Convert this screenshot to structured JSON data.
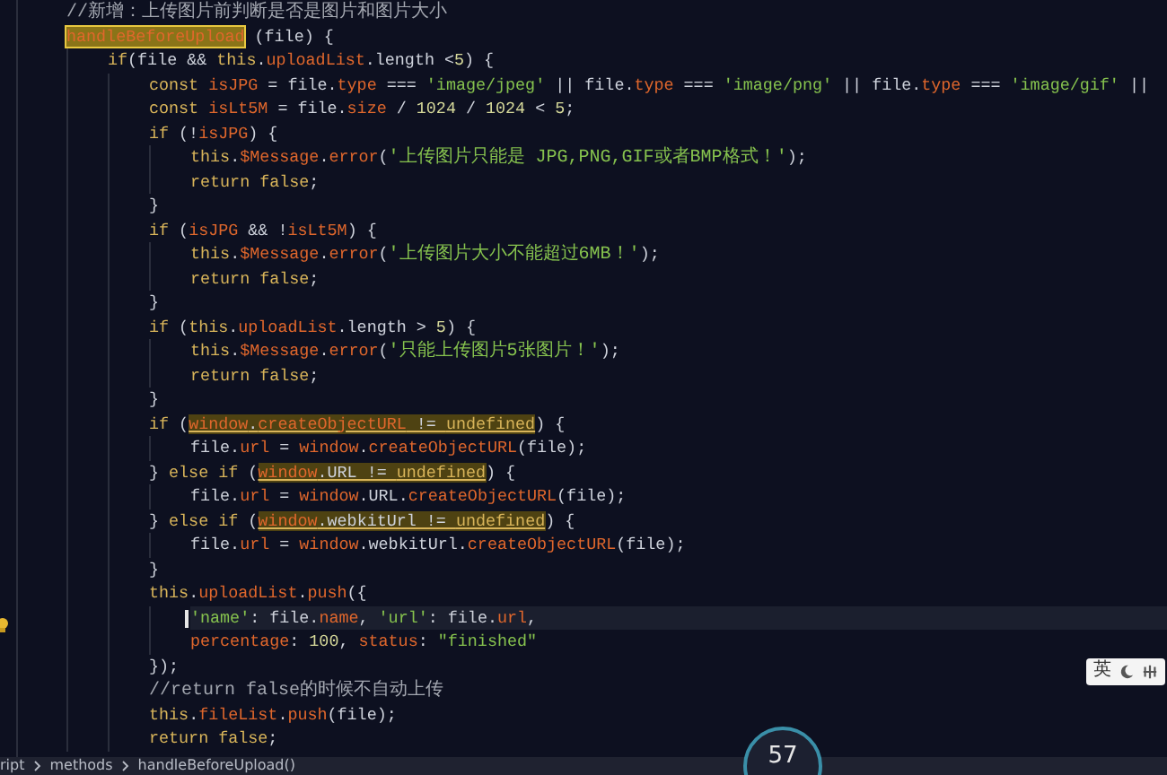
{
  "editor": {
    "lines": [
      {
        "tokens": [
          {
            "kind": "comment",
            "text": "//新增：上传图片前判断是否是图片和图片大小"
          }
        ]
      },
      {
        "tokens": [
          {
            "kind": "current_match",
            "tokens": [
              {
                "kind": "prop",
                "text": "handleBeforeUpload"
              }
            ]
          },
          {
            "kind": "plain",
            "text": " (file) {"
          }
        ],
        "children": [
          {
            "tokens": [
              {
                "kind": "kw",
                "text": "if"
              },
              {
                "kind": "plain",
                "text": "(file && "
              },
              {
                "kind": "kw",
                "text": "this"
              },
              {
                "kind": "plain",
                "text": "."
              },
              {
                "kind": "prop",
                "text": "uploadList"
              },
              {
                "kind": "plain",
                "text": ".length <"
              },
              {
                "kind": "num",
                "text": "5"
              },
              {
                "kind": "plain",
                "text": ") {"
              }
            ],
            "children": [
              {
                "tokens": [
                  {
                    "kind": "kw",
                    "text": "const "
                  },
                  {
                    "kind": "prop",
                    "text": "isJPG"
                  },
                  {
                    "kind": "plain",
                    "text": " = file."
                  },
                  {
                    "kind": "prop",
                    "text": "type"
                  },
                  {
                    "kind": "plain",
                    "text": " === "
                  },
                  {
                    "kind": "str",
                    "text": "'image/jpeg'"
                  },
                  {
                    "kind": "plain",
                    "text": " || file."
                  },
                  {
                    "kind": "prop",
                    "text": "type"
                  },
                  {
                    "kind": "plain",
                    "text": " === "
                  },
                  {
                    "kind": "str",
                    "text": "'image/png'"
                  },
                  {
                    "kind": "plain",
                    "text": " || file."
                  },
                  {
                    "kind": "prop",
                    "text": "type"
                  },
                  {
                    "kind": "plain",
                    "text": " === "
                  },
                  {
                    "kind": "str",
                    "text": "'image/gif'"
                  },
                  {
                    "kind": "plain",
                    "text": " ||"
                  }
                ]
              },
              {
                "tokens": [
                  {
                    "kind": "kw",
                    "text": "const "
                  },
                  {
                    "kind": "prop",
                    "text": "isLt5M"
                  },
                  {
                    "kind": "plain",
                    "text": " = file."
                  },
                  {
                    "kind": "prop",
                    "text": "size"
                  },
                  {
                    "kind": "plain",
                    "text": " / "
                  },
                  {
                    "kind": "num",
                    "text": "1024"
                  },
                  {
                    "kind": "plain",
                    "text": " / "
                  },
                  {
                    "kind": "num",
                    "text": "1024"
                  },
                  {
                    "kind": "plain",
                    "text": " < "
                  },
                  {
                    "kind": "num",
                    "text": "5"
                  },
                  {
                    "kind": "plain",
                    "text": ";"
                  }
                ]
              },
              {
                "tokens": [
                  {
                    "kind": "kw",
                    "text": "if"
                  },
                  {
                    "kind": "plain",
                    "text": " (!"
                  },
                  {
                    "kind": "prop",
                    "text": "isJPG"
                  },
                  {
                    "kind": "plain",
                    "text": ") {"
                  }
                ],
                "children": [
                  {
                    "tokens": [
                      {
                        "kind": "kw",
                        "text": "this"
                      },
                      {
                        "kind": "plain",
                        "text": "."
                      },
                      {
                        "kind": "prop",
                        "text": "$Message"
                      },
                      {
                        "kind": "plain",
                        "text": "."
                      },
                      {
                        "kind": "prop",
                        "text": "error"
                      },
                      {
                        "kind": "plain",
                        "text": "("
                      },
                      {
                        "kind": "message",
                        "text": "'上传图片只能是 JPG,PNG,GIF或者BMP格式！'"
                      },
                      {
                        "kind": "plain",
                        "text": ");"
                      }
                    ]
                  },
                  {
                    "tokens": [
                      {
                        "kind": "kw",
                        "text": "return false"
                      },
                      {
                        "kind": "plain",
                        "text": ";"
                      }
                    ]
                  }
                ]
              },
              {
                "tokens": [
                  {
                    "kind": "plain",
                    "text": "}"
                  }
                ]
              },
              {
                "tokens": [
                  {
                    "kind": "kw",
                    "text": "if"
                  },
                  {
                    "kind": "plain",
                    "text": " ("
                  },
                  {
                    "kind": "prop",
                    "text": "isJPG"
                  },
                  {
                    "kind": "plain",
                    "text": " && !"
                  },
                  {
                    "kind": "prop",
                    "text": "isLt5M"
                  },
                  {
                    "kind": "plain",
                    "text": ") {"
                  }
                ],
                "children": [
                  {
                    "tokens": [
                      {
                        "kind": "kw",
                        "text": "this"
                      },
                      {
                        "kind": "plain",
                        "text": "."
                      },
                      {
                        "kind": "prop",
                        "text": "$Message"
                      },
                      {
                        "kind": "plain",
                        "text": "."
                      },
                      {
                        "kind": "prop",
                        "text": "error"
                      },
                      {
                        "kind": "plain",
                        "text": "("
                      },
                      {
                        "kind": "message",
                        "text": "'上传图片大小不能超过6MB！'"
                      },
                      {
                        "kind": "plain",
                        "text": ");"
                      }
                    ]
                  },
                  {
                    "tokens": [
                      {
                        "kind": "kw",
                        "text": "return false"
                      },
                      {
                        "kind": "plain",
                        "text": ";"
                      }
                    ]
                  }
                ]
              },
              {
                "tokens": [
                  {
                    "kind": "plain",
                    "text": "}"
                  }
                ]
              },
              {
                "tokens": [
                  {
                    "kind": "kw",
                    "text": "if"
                  },
                  {
                    "kind": "plain",
                    "text": " ("
                  },
                  {
                    "kind": "kw",
                    "text": "this"
                  },
                  {
                    "kind": "plain",
                    "text": "."
                  },
                  {
                    "kind": "prop",
                    "text": "uploadList"
                  },
                  {
                    "kind": "plain",
                    "text": ".length > "
                  },
                  {
                    "kind": "num",
                    "text": "5"
                  },
                  {
                    "kind": "plain",
                    "text": ") {"
                  }
                ],
                "children": [
                  {
                    "tokens": [
                      {
                        "kind": "kw",
                        "text": "this"
                      },
                      {
                        "kind": "plain",
                        "text": "."
                      },
                      {
                        "kind": "prop",
                        "text": "$Message"
                      },
                      {
                        "kind": "plain",
                        "text": "."
                      },
                      {
                        "kind": "prop",
                        "text": "error"
                      },
                      {
                        "kind": "plain",
                        "text": "("
                      },
                      {
                        "kind": "message",
                        "text": "'只能上传图片5张图片！'"
                      },
                      {
                        "kind": "plain",
                        "text": ");"
                      }
                    ]
                  },
                  {
                    "tokens": [
                      {
                        "kind": "kw",
                        "text": "return false"
                      },
                      {
                        "kind": "plain",
                        "text": ";"
                      }
                    ]
                  }
                ]
              },
              {
                "tokens": [
                  {
                    "kind": "plain",
                    "text": "}"
                  }
                ]
              },
              {
                "tokens": [
                  {
                    "kind": "kw",
                    "text": "if"
                  },
                  {
                    "kind": "plain",
                    "text": " ("
                  },
                  {
                    "kind": "match",
                    "tokens": [
                      {
                        "kind": "prop",
                        "text": "window"
                      },
                      {
                        "kind": "plain",
                        "text": "."
                      },
                      {
                        "kind": "prop",
                        "text": "createObjectURL"
                      },
                      {
                        "kind": "plain",
                        "text": " != "
                      },
                      {
                        "kind": "kw",
                        "text": "undefined"
                      }
                    ]
                  },
                  {
                    "kind": "plain",
                    "text": ") {"
                  }
                ],
                "children": [
                  {
                    "tokens": [
                      {
                        "kind": "plain",
                        "text": "file."
                      },
                      {
                        "kind": "prop",
                        "text": "url"
                      },
                      {
                        "kind": "plain",
                        "text": " = "
                      },
                      {
                        "kind": "prop",
                        "text": "window"
                      },
                      {
                        "kind": "plain",
                        "text": "."
                      },
                      {
                        "kind": "prop",
                        "text": "createObjectURL"
                      },
                      {
                        "kind": "plain",
                        "text": "(file);"
                      }
                    ]
                  }
                ]
              },
              {
                "tokens": [
                  {
                    "kind": "plain",
                    "text": "} "
                  },
                  {
                    "kind": "kw",
                    "text": "else if"
                  },
                  {
                    "kind": "plain",
                    "text": " ("
                  },
                  {
                    "kind": "match",
                    "tokens": [
                      {
                        "kind": "prop",
                        "text": "window"
                      },
                      {
                        "kind": "plain",
                        "text": ".URL != "
                      },
                      {
                        "kind": "kw",
                        "text": "undefined"
                      }
                    ]
                  },
                  {
                    "kind": "plain",
                    "text": ") {"
                  }
                ],
                "children": [
                  {
                    "tokens": [
                      {
                        "kind": "plain",
                        "text": "file."
                      },
                      {
                        "kind": "prop",
                        "text": "url"
                      },
                      {
                        "kind": "plain",
                        "text": " = "
                      },
                      {
                        "kind": "prop",
                        "text": "window"
                      },
                      {
                        "kind": "plain",
                        "text": ".URL."
                      },
                      {
                        "kind": "prop",
                        "text": "createObjectURL"
                      },
                      {
                        "kind": "plain",
                        "text": "(file);"
                      }
                    ]
                  }
                ]
              },
              {
                "tokens": [
                  {
                    "kind": "plain",
                    "text": "} "
                  },
                  {
                    "kind": "kw",
                    "text": "else if"
                  },
                  {
                    "kind": "plain",
                    "text": " ("
                  },
                  {
                    "kind": "match",
                    "tokens": [
                      {
                        "kind": "prop",
                        "text": "window"
                      },
                      {
                        "kind": "plain",
                        "text": ".webkitUrl != "
                      },
                      {
                        "kind": "kw",
                        "text": "undefined"
                      }
                    ]
                  },
                  {
                    "kind": "plain",
                    "text": ") {"
                  }
                ],
                "children": [
                  {
                    "tokens": [
                      {
                        "kind": "plain",
                        "text": "file."
                      },
                      {
                        "kind": "prop",
                        "text": "url"
                      },
                      {
                        "kind": "plain",
                        "text": " = "
                      },
                      {
                        "kind": "prop",
                        "text": "window"
                      },
                      {
                        "kind": "plain",
                        "text": ".webkitUrl."
                      },
                      {
                        "kind": "prop",
                        "text": "createObjectURL"
                      },
                      {
                        "kind": "plain",
                        "text": "(file);"
                      }
                    ]
                  }
                ]
              },
              {
                "tokens": [
                  {
                    "kind": "plain",
                    "text": "}"
                  }
                ]
              },
              {
                "tokens": [
                  {
                    "kind": "kw",
                    "text": "this"
                  },
                  {
                    "kind": "plain",
                    "text": "."
                  },
                  {
                    "kind": "prop",
                    "text": "uploadList"
                  },
                  {
                    "kind": "plain",
                    "text": "."
                  },
                  {
                    "kind": "prop",
                    "text": "push"
                  },
                  {
                    "kind": "plain",
                    "text": "({"
                  }
                ],
                "children": [
                  {
                    "current": true,
                    "tokens": [
                      {
                        "kind": "str",
                        "text": "'name'"
                      },
                      {
                        "kind": "plain",
                        "text": ": file."
                      },
                      {
                        "kind": "prop",
                        "text": "name"
                      },
                      {
                        "kind": "plain",
                        "text": ", "
                      },
                      {
                        "kind": "str",
                        "text": "'url'"
                      },
                      {
                        "kind": "plain",
                        "text": ": file."
                      },
                      {
                        "kind": "prop",
                        "text": "url"
                      },
                      {
                        "kind": "plain",
                        "text": ","
                      }
                    ]
                  },
                  {
                    "tokens": [
                      {
                        "kind": "prop",
                        "text": "percentage"
                      },
                      {
                        "kind": "plain",
                        "text": ": "
                      },
                      {
                        "kind": "num",
                        "text": "100"
                      },
                      {
                        "kind": "plain",
                        "text": ", "
                      },
                      {
                        "kind": "prop",
                        "text": "status"
                      },
                      {
                        "kind": "plain",
                        "text": ": "
                      },
                      {
                        "kind": "str",
                        "text": "\"finished\""
                      }
                    ]
                  }
                ]
              },
              {
                "tokens": [
                  {
                    "kind": "plain",
                    "text": "});"
                  }
                ]
              },
              {
                "tokens": [
                  {
                    "kind": "comment",
                    "text": "//return false的时候不自动上传"
                  }
                ]
              },
              {
                "tokens": [
                  {
                    "kind": "kw",
                    "text": "this"
                  },
                  {
                    "kind": "plain",
                    "text": "."
                  },
                  {
                    "kind": "prop",
                    "text": "fileList"
                  },
                  {
                    "kind": "plain",
                    "text": "."
                  },
                  {
                    "kind": "prop",
                    "text": "push"
                  },
                  {
                    "kind": "plain",
                    "text": "(file);"
                  }
                ]
              },
              {
                "tokens": [
                  {
                    "kind": "kw",
                    "text": "return false"
                  },
                  {
                    "kind": "plain",
                    "text": ";"
                  }
                ]
              }
            ]
          }
        ]
      }
    ]
  },
  "ime_toolbar": {
    "label": "英"
  },
  "speed_widget": {
    "value": "57"
  },
  "breadcrumb": [
    "ript",
    "methods",
    "handleBeforeUpload()"
  ]
}
